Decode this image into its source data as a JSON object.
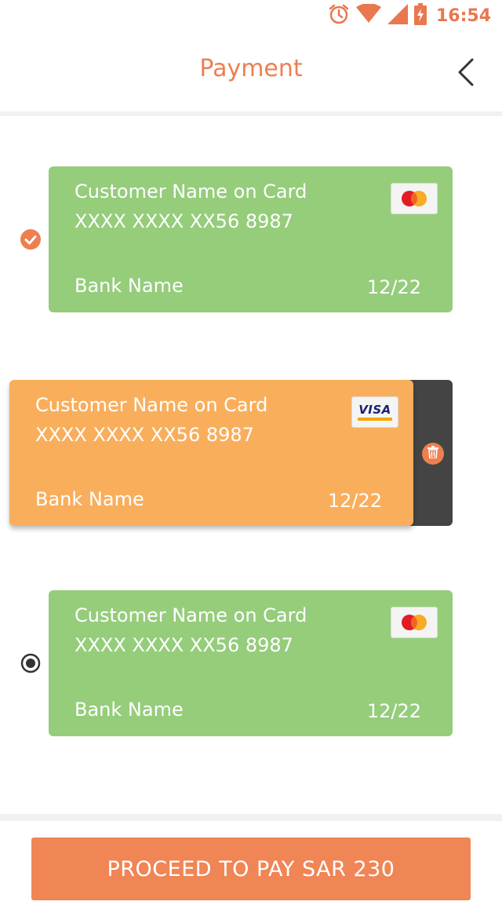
{
  "status_bar": {
    "time": "16:54",
    "icons": [
      "alarm-icon",
      "wifi-icon",
      "signal-icon",
      "battery-charging-icon"
    ]
  },
  "header": {
    "title": "Payment",
    "back_icon": "chevron-left-icon"
  },
  "cards": [
    {
      "name": "Customer Name on Card",
      "number": "XXXX XXXX XX56 8987",
      "bank": "Bank Name",
      "expiry": "12/22",
      "brand": "mastercard",
      "color": "#95cd7b",
      "state": "selected"
    },
    {
      "name": "Customer Name on Card",
      "number": "XXXX XXXX XX56 8987",
      "bank": "Bank Name",
      "expiry": "12/22",
      "brand": "visa",
      "brand_label": "VISA",
      "color": "#f9ae5c",
      "state": "swiped-delete"
    },
    {
      "name": "Customer Name on Card",
      "number": "XXXX XXXX XX56 8987",
      "bank": "Bank Name",
      "expiry": "12/22",
      "brand": "mastercard",
      "color": "#95cd7b",
      "state": "unselected"
    }
  ],
  "footer": {
    "pay_label": "PROCEED TO PAY SAR 230"
  },
  "colors": {
    "accent": "#ee7f50",
    "delete_panel": "#444444"
  }
}
